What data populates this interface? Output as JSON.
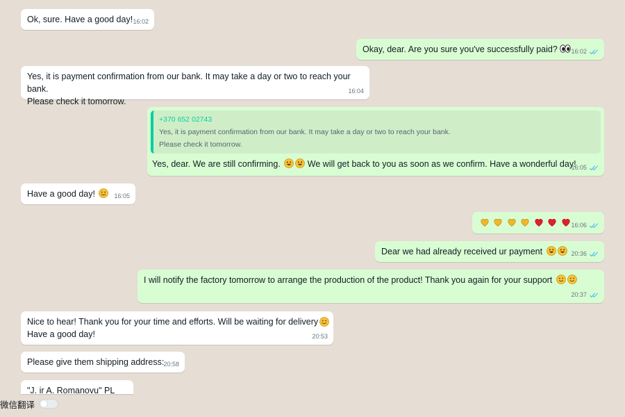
{
  "messages": [
    {
      "text": "Ok, sure. Have a good day!",
      "time": "16:02"
    },
    {
      "text": "Okay, dear. Are you sure you've successfully paid?",
      "time": "16:02",
      "emoji": "eyes"
    },
    {
      "text": "Yes, it is payment confirmation from our bank. It may take a day or two to reach your bank.\nPlease check it tomorrow.",
      "time": "16:04"
    },
    {
      "quote_from": "+370 652 02743",
      "quote_text": "Yes, it is payment confirmation from our bank. It may take a day or two to reach your bank.\nPlease check it tomorrow.",
      "text": "Yes, dear. We are still confirming.",
      "text2": "We will get back to you as soon as we confirm. Have a wonderful day!",
      "time": "16:05"
    },
    {
      "text": "Have a good day!",
      "time": "16:05"
    },
    {
      "time": "16:06",
      "emoji": "hearts"
    },
    {
      "text": "Dear we had already received ur payment",
      "time": "20:36"
    },
    {
      "text": "I will notify the factory tomorrow to arrange the production of the product! Thank you again for your support",
      "time": "20:37"
    },
    {
      "text": "Nice to hear! Thank you for your time and efforts. Will be waiting for delivery\nHave a good day!",
      "time": "20:53"
    },
    {
      "text": "Please give them shipping address:",
      "time": "20:58"
    },
    {
      "text": "\"J. ir A. Romanovu\" PL"
    }
  ],
  "footer": {
    "label": "微信翻译"
  },
  "colors": {
    "incoming": "#ffffff",
    "outgoing": "#d9fdd3",
    "read_ticks": "#53bdeb",
    "quote_accent": "#06cf9c",
    "background": "#e6ddd4"
  }
}
